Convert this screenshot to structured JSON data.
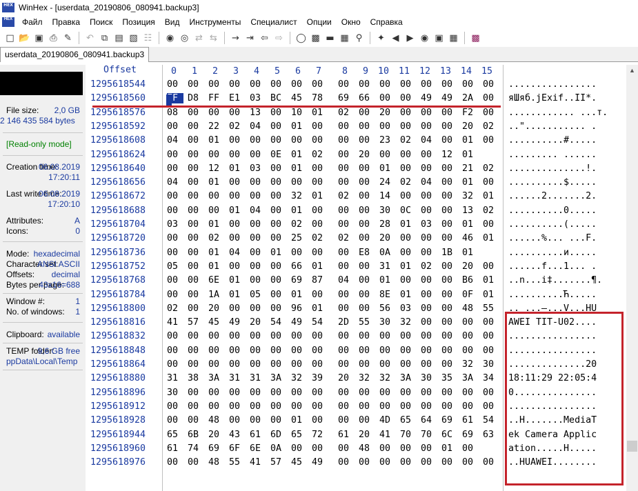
{
  "window": {
    "title": "WinHex - [userdata_20190806_080941.backup3]",
    "app_icon": "HEX"
  },
  "menu": {
    "icon": "HEX",
    "items": [
      "Файл",
      "Правка",
      "Поиск",
      "Позиция",
      "Вид",
      "Инструменты",
      "Специалист",
      "Опции",
      "Окно",
      "Справка"
    ]
  },
  "toolbar": {
    "icons": [
      "new-file-icon",
      "open-file-icon",
      "save-icon",
      "print-icon",
      "properties-icon",
      "undo-icon",
      "copy-icon",
      "paste-icon",
      "paste-special-icon",
      "copy-hex-icon",
      "find-icon",
      "find-hex-icon",
      "replace-icon",
      "replace-hex-icon",
      "goto-offset-icon",
      "goto-sector-icon",
      "back-icon",
      "forward-icon",
      "disk-icon",
      "ram-icon",
      "drive-icon",
      "calculator-icon",
      "search-icon",
      "wizard-icon",
      "prev-icon",
      "next-icon",
      "binoculars-icon",
      "camera-icon",
      "table-icon",
      "book-icon"
    ]
  },
  "tab": {
    "label": "userdata_20190806_080941.backup3"
  },
  "side": {
    "file_size_label": "File size:",
    "file_size_value": "2,0 GB",
    "file_size_bytes": "2 146 435 584 bytes",
    "mode_readonly": "[Read-only mode]",
    "creation_label": "Creation time:",
    "creation_date": "06.08.2019",
    "creation_time": "17:20:11",
    "last_write_label": "Last write time:",
    "last_write_date": "06.08.2019",
    "last_write_time": "17:20:10",
    "attributes_label": "Attributes:",
    "attributes_value": "A",
    "icons_label": "Icons:",
    "icons_value": "0",
    "mode_label": "Mode:",
    "mode_value": "hexadecimal",
    "charset_label": "Character set:",
    "charset_value": "ANSI ASCII",
    "offsets_label": "Offsets:",
    "offsets_value": "decimal",
    "bytes_per_page_label": "Bytes per page:",
    "bytes_per_page_value": "43x16=688",
    "window_num_label": "Window #:",
    "window_num_value": "1",
    "num_windows_label": "No. of windows:",
    "num_windows_value": "1",
    "clipboard_label": "Clipboard:",
    "clipboard_value": "available",
    "temp_label": "TEMP folder:",
    "temp_value": "9,6 GB free",
    "temp_path": "ppData\\Local\\Temp"
  },
  "hex": {
    "offset_header": "Offset",
    "columns": [
      "0",
      "1",
      "2",
      "3",
      "4",
      "5",
      "6",
      "7",
      "8",
      "9",
      "10",
      "11",
      "12",
      "13",
      "14",
      "15"
    ],
    "rows": [
      {
        "offset": "1295618544",
        "bytes": [
          "00",
          "00",
          "00",
          "00",
          "00",
          "00",
          "00",
          "00",
          "00",
          "00",
          "00",
          "00",
          "00",
          "00",
          "00",
          "00"
        ],
        "text": "................"
      },
      {
        "offset": "1295618560",
        "bytes": [
          "FF",
          "D8",
          "FF",
          "E1",
          "03",
          "BC",
          "45",
          "78",
          "69",
          "66",
          "00",
          "00",
          "49",
          "49",
          "2A",
          "00"
        ],
        "text": "яШяб.јExif..II*."
      },
      {
        "offset": "1295618576",
        "bytes": [
          "08",
          "00",
          "00",
          "00",
          "13",
          "00",
          "10",
          "01",
          "02",
          "00",
          "20",
          "00",
          "00",
          "00",
          "F2",
          "00"
        ],
        "text": "............ ...т."
      },
      {
        "offset": "1295618592",
        "bytes": [
          "00",
          "00",
          "22",
          "02",
          "04",
          "00",
          "01",
          "00",
          "00",
          "00",
          "00",
          "00",
          "00",
          "00",
          "20",
          "02"
        ],
        "text": "..\"........... ."
      },
      {
        "offset": "1295618608",
        "bytes": [
          "04",
          "00",
          "01",
          "00",
          "00",
          "00",
          "00",
          "00",
          "00",
          "00",
          "23",
          "02",
          "04",
          "00",
          "01",
          "00"
        ],
        "text": "..........#....."
      },
      {
        "offset": "1295618624",
        "bytes": [
          "00",
          "00",
          "00",
          "00",
          "00",
          "0E",
          "01",
          "02",
          "00",
          "20",
          "00",
          "00",
          "00",
          "12",
          "01"
        ],
        "text": "......... ......"
      },
      {
        "offset": "1295618640",
        "bytes": [
          "00",
          "00",
          "12",
          "01",
          "03",
          "00",
          "01",
          "00",
          "00",
          "00",
          "01",
          "00",
          "00",
          "00",
          "21",
          "02"
        ],
        "text": "..............!."
      },
      {
        "offset": "1295618656",
        "bytes": [
          "04",
          "00",
          "01",
          "00",
          "00",
          "00",
          "00",
          "00",
          "00",
          "00",
          "24",
          "02",
          "04",
          "00",
          "01",
          "00"
        ],
        "text": "..........$....."
      },
      {
        "offset": "1295618672",
        "bytes": [
          "00",
          "00",
          "00",
          "00",
          "00",
          "00",
          "32",
          "01",
          "02",
          "00",
          "14",
          "00",
          "00",
          "00",
          "32",
          "01"
        ],
        "text": "......2.......2."
      },
      {
        "offset": "1295618688",
        "bytes": [
          "00",
          "00",
          "00",
          "01",
          "04",
          "00",
          "01",
          "00",
          "00",
          "00",
          "30",
          "0C",
          "00",
          "00",
          "13",
          "02"
        ],
        "text": "..........0....."
      },
      {
        "offset": "1295618704",
        "bytes": [
          "03",
          "00",
          "01",
          "00",
          "00",
          "00",
          "02",
          "00",
          "00",
          "00",
          "28",
          "01",
          "03",
          "00",
          "01",
          "00"
        ],
        "text": "..........(....."
      },
      {
        "offset": "1295618720",
        "bytes": [
          "00",
          "00",
          "02",
          "00",
          "00",
          "00",
          "25",
          "02",
          "02",
          "00",
          "20",
          "00",
          "00",
          "00",
          "46",
          "01"
        ],
        "text": "......%... ...F."
      },
      {
        "offset": "1295618736",
        "bytes": [
          "00",
          "00",
          "01",
          "04",
          "00",
          "01",
          "00",
          "00",
          "00",
          "E8",
          "0A",
          "00",
          "00",
          "1B",
          "01"
        ],
        "text": "..........и....."
      },
      {
        "offset": "1295618752",
        "bytes": [
          "05",
          "00",
          "01",
          "00",
          "00",
          "00",
          "66",
          "01",
          "00",
          "00",
          "31",
          "01",
          "02",
          "00",
          "20",
          "00"
        ],
        "text": "......f...1... ."
      },
      {
        "offset": "1295618768",
        "bytes": [
          "00",
          "00",
          "6E",
          "01",
          "00",
          "00",
          "69",
          "87",
          "04",
          "00",
          "01",
          "00",
          "00",
          "00",
          "B6",
          "01"
        ],
        "text": "..n...i‡.......¶."
      },
      {
        "offset": "1295618784",
        "bytes": [
          "00",
          "00",
          "1A",
          "01",
          "05",
          "00",
          "01",
          "00",
          "00",
          "00",
          "8E",
          "01",
          "00",
          "00",
          "0F",
          "01"
        ],
        "text": "..........Ћ....."
      },
      {
        "offset": "1295618800",
        "bytes": [
          "02",
          "00",
          "20",
          "00",
          "00",
          "00",
          "96",
          "01",
          "00",
          "00",
          "56",
          "03",
          "00",
          "00",
          "48",
          "55"
        ],
        "text": ".. ...–...V...HU"
      },
      {
        "offset": "1295618816",
        "bytes": [
          "41",
          "57",
          "45",
          "49",
          "20",
          "54",
          "49",
          "54",
          "2D",
          "55",
          "30",
          "32",
          "00",
          "00",
          "00",
          "00"
        ],
        "text": "AWEI TIT-U02...."
      },
      {
        "offset": "1295618832",
        "bytes": [
          "00",
          "00",
          "00",
          "00",
          "00",
          "00",
          "00",
          "00",
          "00",
          "00",
          "00",
          "00",
          "00",
          "00",
          "00",
          "00"
        ],
        "text": "................"
      },
      {
        "offset": "1295618848",
        "bytes": [
          "00",
          "00",
          "00",
          "00",
          "00",
          "00",
          "00",
          "00",
          "00",
          "00",
          "00",
          "00",
          "00",
          "00",
          "00",
          "00"
        ],
        "text": "................"
      },
      {
        "offset": "1295618864",
        "bytes": [
          "00",
          "00",
          "00",
          "00",
          "00",
          "00",
          "00",
          "00",
          "00",
          "00",
          "00",
          "00",
          "00",
          "00",
          "32",
          "30"
        ],
        "text": "..............20"
      },
      {
        "offset": "1295618880",
        "bytes": [
          "31",
          "38",
          "3A",
          "31",
          "31",
          "3A",
          "32",
          "39",
          "20",
          "32",
          "32",
          "3A",
          "30",
          "35",
          "3A",
          "34"
        ],
        "text": "18:11:29 22:05:4"
      },
      {
        "offset": "1295618896",
        "bytes": [
          "30",
          "00",
          "00",
          "00",
          "00",
          "00",
          "00",
          "00",
          "00",
          "00",
          "00",
          "00",
          "00",
          "00",
          "00",
          "00"
        ],
        "text": "0..............."
      },
      {
        "offset": "1295618912",
        "bytes": [
          "00",
          "00",
          "00",
          "00",
          "00",
          "00",
          "00",
          "00",
          "00",
          "00",
          "00",
          "00",
          "00",
          "00",
          "00",
          "00"
        ],
        "text": "................"
      },
      {
        "offset": "1295618928",
        "bytes": [
          "00",
          "00",
          "48",
          "00",
          "00",
          "00",
          "01",
          "00",
          "00",
          "00",
          "4D",
          "65",
          "64",
          "69",
          "61",
          "54"
        ],
        "text": "..H.......MediaT"
      },
      {
        "offset": "1295618944",
        "bytes": [
          "65",
          "6B",
          "20",
          "43",
          "61",
          "6D",
          "65",
          "72",
          "61",
          "20",
          "41",
          "70",
          "70",
          "6C",
          "69",
          "63"
        ],
        "text": "ek Camera Applic"
      },
      {
        "offset": "1295618960",
        "bytes": [
          "61",
          "74",
          "69",
          "6F",
          "6E",
          "0A",
          "00",
          "00",
          "00",
          "48",
          "00",
          "00",
          "00",
          "01",
          "00"
        ],
        "text": "ation.....H....."
      },
      {
        "offset": "1295618976",
        "bytes": [
          "00",
          "00",
          "48",
          "55",
          "41",
          "57",
          "45",
          "49",
          "00",
          "00",
          "00",
          "00",
          "00",
          "00",
          "00",
          "00"
        ],
        "text": "..HUAWEI........"
      }
    ]
  },
  "colors": {
    "accent_blue": "#1a3aa0",
    "highlight_red": "#c4232b",
    "readonly_green": "#008000"
  }
}
